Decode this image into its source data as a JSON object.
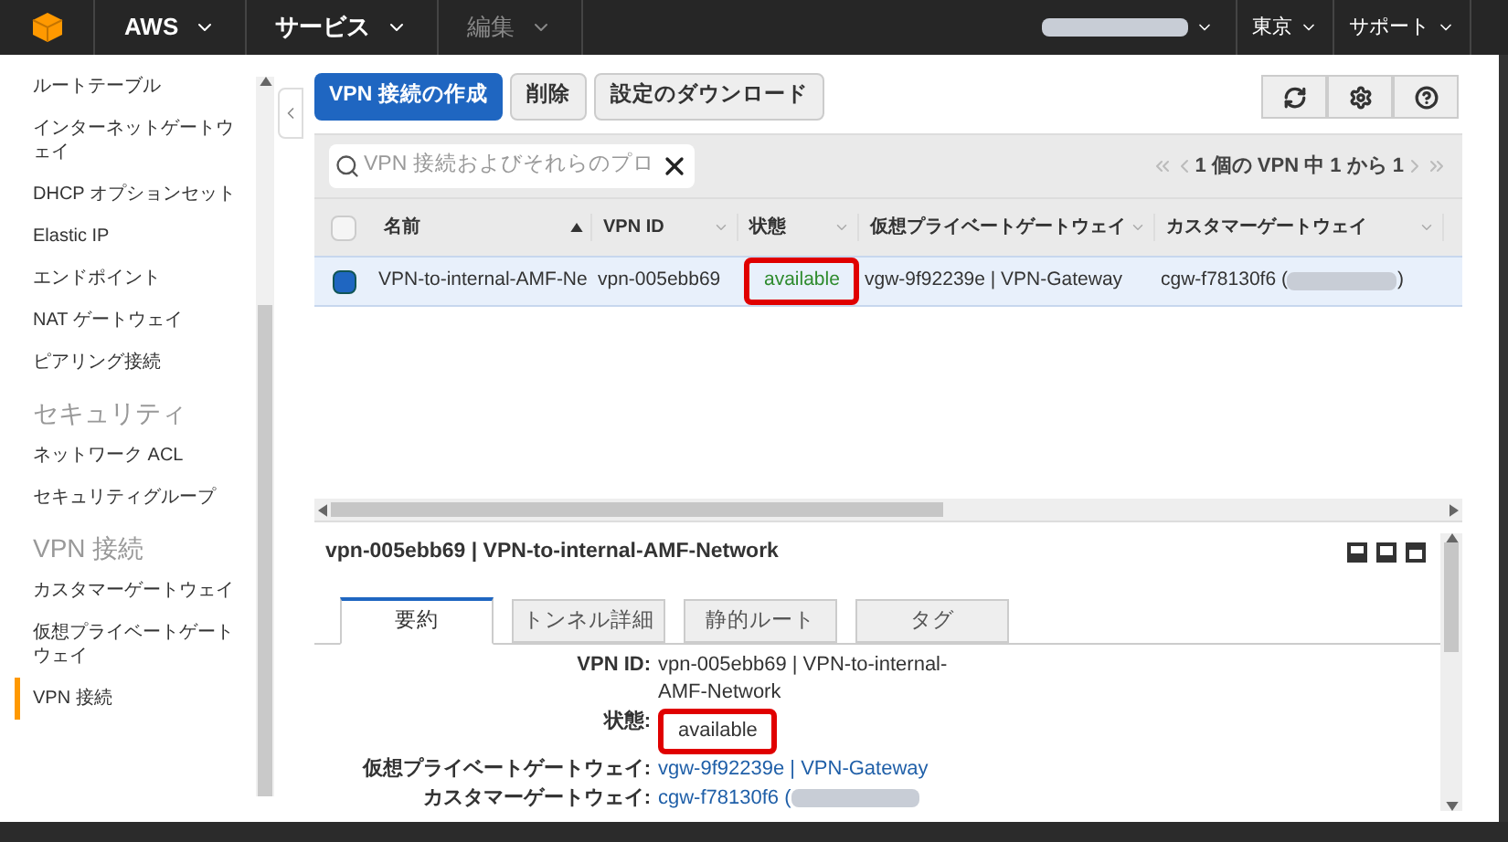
{
  "topbar": {
    "menus": [
      {
        "label": "AWS",
        "disabled": false
      },
      {
        "label": "サービス",
        "disabled": false
      },
      {
        "label": "編集",
        "disabled": true
      }
    ],
    "right_menus": [
      "東京",
      "サポート"
    ]
  },
  "sidebar": {
    "items": [
      {
        "kind": "item",
        "label": "ルートテーブル",
        "selected": false
      },
      {
        "kind": "item",
        "label": "インターネットゲートウェイ",
        "selected": false
      },
      {
        "kind": "item",
        "label": "DHCP オプションセット",
        "selected": false
      },
      {
        "kind": "item",
        "label": "Elastic IP",
        "selected": false
      },
      {
        "kind": "item",
        "label": "エンドポイント",
        "selected": false
      },
      {
        "kind": "item",
        "label": "NAT ゲートウェイ",
        "selected": false
      },
      {
        "kind": "item",
        "label": "ピアリング接続",
        "selected": false
      },
      {
        "kind": "heading",
        "label": "セキュリティ"
      },
      {
        "kind": "item",
        "label": "ネットワーク ACL",
        "selected": false
      },
      {
        "kind": "item",
        "label": "セキュリティグループ",
        "selected": false
      },
      {
        "kind": "heading",
        "label": "VPN 接続"
      },
      {
        "kind": "item",
        "label": "カスタマーゲートウェイ",
        "selected": false
      },
      {
        "kind": "item",
        "label": "仮想プライベートゲートウェイ",
        "selected": false
      },
      {
        "kind": "item",
        "label": "VPN 接続",
        "selected": true
      }
    ]
  },
  "toolbar": {
    "buttons": [
      {
        "label": "VPN 接続の作成",
        "kind": "primary"
      },
      {
        "label": "削除",
        "kind": "secondary"
      },
      {
        "label": "設定のダウンロード",
        "kind": "secondary"
      }
    ]
  },
  "search": {
    "placeholder": "VPN 接続およびそれらのプロ"
  },
  "pagination": "1 個の VPN 中 1 から 1",
  "table": {
    "select_all_checked": false,
    "columns": [
      {
        "label": "名前",
        "sorted": true
      },
      {
        "label": "VPN ID",
        "sorted": false
      },
      {
        "label": "状態",
        "sorted": false
      },
      {
        "label": "仮想プライベートゲートウェイ",
        "sorted": false
      },
      {
        "label": "カスタマーゲートウェイ",
        "sorted": false
      }
    ],
    "rows": [
      {
        "selected": true,
        "cells": [
          {
            "text": "VPN-to-internal-AMF-Ne",
            "kind": "text",
            "highlighted": false
          },
          {
            "text": "vpn-005ebb69",
            "kind": "text",
            "highlighted": false
          },
          {
            "text": "available",
            "kind": "status",
            "highlighted": true
          },
          {
            "text": "vgw-9f92239e | VPN-Gateway",
            "kind": "text",
            "highlighted": false
          },
          {
            "text": "cgw-f78130f6 (",
            "kind": "redacted",
            "suffix": ")",
            "highlighted": false
          }
        ]
      }
    ]
  },
  "detail": {
    "title": "vpn-005ebb69 | VPN-to-internal-AMF-Network",
    "tabs": [
      {
        "label": "要約",
        "selected": true
      },
      {
        "label": "トンネル詳細",
        "selected": false
      },
      {
        "label": "静的ルート",
        "selected": false
      },
      {
        "label": "タグ",
        "selected": false
      }
    ],
    "fields": [
      {
        "label": "VPN ID:",
        "value": "vpn-005ebb69 | VPN-to-internal-AMF-Network",
        "kind": "text",
        "highlighted": false
      },
      {
        "label": "状態:",
        "value": "available",
        "kind": "text",
        "highlighted": true
      },
      {
        "label": "仮想プライベートゲートウェイ:",
        "value": "vgw-9f92239e | VPN-Gateway",
        "kind": "link",
        "highlighted": false
      },
      {
        "label": "カスタマーゲートウェイ:",
        "value": "cgw-f78130f6 (",
        "kind": "link",
        "redacted": true,
        "highlighted": false
      }
    ]
  }
}
